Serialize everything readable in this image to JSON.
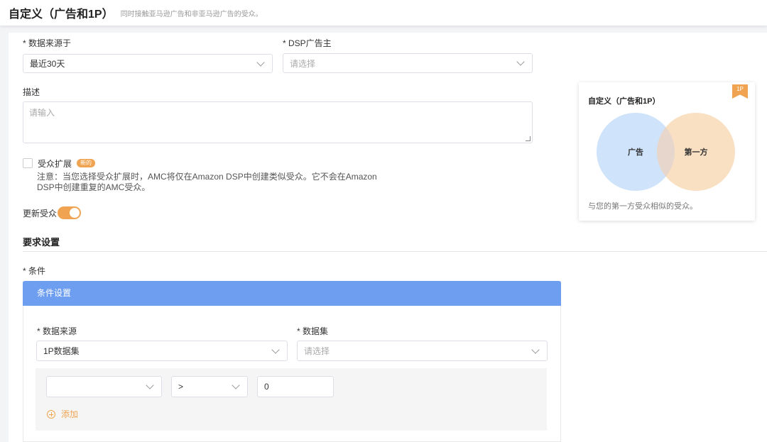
{
  "header": {
    "title": "自定义（广告和1P）",
    "subtitle": "同时接触亚马逊广告和非亚马逊广告的受众。"
  },
  "form": {
    "data_source_label": "* 数据来源于",
    "data_source_value": "最近30天",
    "dsp_advertiser_label": "* DSP广告主",
    "dsp_advertiser_placeholder": "请选择",
    "description_label": "描述",
    "description_placeholder": "请输入",
    "audience_expansion_label": "受众扩展",
    "new_badge": "新的",
    "note": "注意：当您选择受众扩展时，AMC将仅在Amazon DSP中创建类似受众。它不会在Amazon DSP中创建重复的AMC受众。",
    "update_audience_label": "更新受众",
    "update_audience_on": true
  },
  "requirements": {
    "section_title": "要求设置",
    "conditions_label": "* 条件",
    "panel_title": "条件设置",
    "datasource_label": "* 数据来源",
    "datasource_value": "1P数据集",
    "dataset_label": "* 数据集",
    "dataset_placeholder": "请选择",
    "rule": {
      "field_value": "",
      "operator_value": ">",
      "number_value": "0"
    },
    "add_label": "添加"
  },
  "card": {
    "title": "自定义（广告和1P）",
    "badge": "1P",
    "venn_left": "广告",
    "venn_right": "第一方",
    "description": "与您的第一方受众相似的受众。",
    "colors": {
      "left_circle": "#cfe3fb",
      "right_circle": "#f9e0c2",
      "overlap": "#e6d6cc"
    }
  },
  "colors": {
    "accent": "#f0a451",
    "panel_header": "#6e9ef0"
  }
}
